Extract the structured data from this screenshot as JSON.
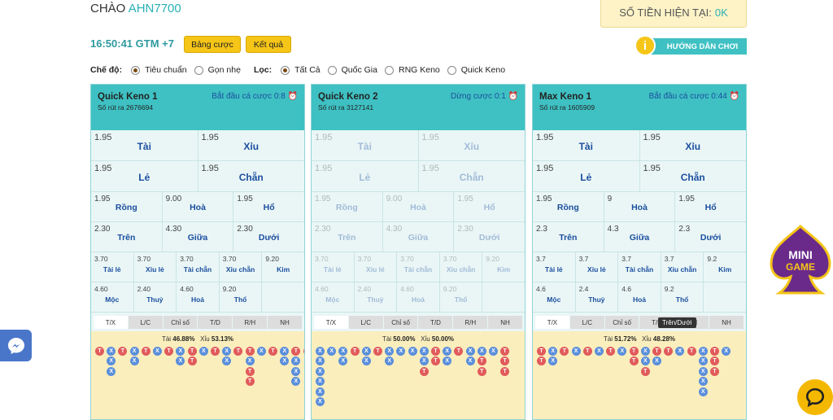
{
  "header": {
    "greeting": "CHÀO",
    "username": "AHN7700",
    "balance_label": "SỐ TIỀN HIỆN TẠI:",
    "balance_value": "0K",
    "clock": "16:50:41 GTM +7",
    "bets_button": "Bảng cược",
    "results_button": "Kết quả",
    "help_label": "HƯỚNG DẪN CHƠI",
    "help_icon": "i"
  },
  "mode": {
    "label": "Chế độ:",
    "options": [
      "Tiêu chuẩn",
      "Gọn nhẹ"
    ],
    "selected": 0
  },
  "filter": {
    "label": "Lọc:",
    "options": [
      "Tất Cả",
      "Quốc Gia",
      "RNG Keno",
      "Quick Keno"
    ],
    "selected": 0
  },
  "tabs": [
    "T/X",
    "L/C",
    "Chỉ số",
    "T/D",
    "R/H",
    "NH"
  ],
  "tooltip": "Trên/Dưới",
  "logo_text": [
    "MINI",
    "GAME"
  ],
  "panels": [
    {
      "name": "Quick Keno 1",
      "draw": "Số rút ra 2676694",
      "status": "Bắt đầu cá cược 0:8",
      "disabled": false,
      "r1": [
        [
          "1.95",
          "Tài"
        ],
        [
          "1.95",
          "Xỉu"
        ],
        [
          "1.95",
          "Lẻ"
        ],
        [
          "1.95",
          "Chẵn"
        ]
      ],
      "r2": [
        [
          "1.95",
          "Rồng"
        ],
        [
          "9.00",
          "Hoà"
        ],
        [
          "1.95",
          "Hổ"
        ],
        [
          "2.30",
          "Trên"
        ],
        [
          "4.30",
          "Giữa"
        ],
        [
          "2.30",
          "Dưới"
        ]
      ],
      "r3": [
        [
          "3.70",
          "Tài lẻ"
        ],
        [
          "3.70",
          "Xỉu lẻ"
        ],
        [
          "3.70",
          "Tài chẵn"
        ],
        [
          "3.70",
          "Xỉu chẵn"
        ],
        [
          "9.20",
          "Kim"
        ],
        [
          "4.60",
          "Mộc"
        ],
        [
          "2.40",
          "Thuỷ"
        ],
        [
          "4.60",
          "Hoả"
        ],
        [
          "9.20",
          "Thổ"
        ]
      ],
      "tai": "Tài",
      "tai_pct": "46.88%",
      "xiu": "Xỉu",
      "xiu_pct": "53.13%",
      "cols": [
        "T",
        "XXX",
        "T",
        "XX",
        "T",
        "X",
        "T",
        "XX",
        "TT",
        "X",
        "T",
        "XX",
        "T",
        "TXTT",
        "X",
        "T",
        "XX",
        "TXXX",
        "T",
        "XX",
        "X",
        "X"
      ]
    },
    {
      "name": "Quick Keno 2",
      "draw": "Số rút ra 3127141",
      "status": "Dừng cược 0:1",
      "disabled": true,
      "r1": [
        [
          "1.95",
          "Tài"
        ],
        [
          "1.95",
          "Xỉu"
        ],
        [
          "1.95",
          "Lẻ"
        ],
        [
          "1.95",
          "Chẵn"
        ]
      ],
      "r2": [
        [
          "1.95",
          "Rồng"
        ],
        [
          "9.00",
          "Hoà"
        ],
        [
          "1.95",
          "Hổ"
        ],
        [
          "2.30",
          "Trên"
        ],
        [
          "4.30",
          "Giữa"
        ],
        [
          "2.30",
          "Dưới"
        ]
      ],
      "r3": [
        [
          "3.70",
          "Tài lẻ"
        ],
        [
          "3.70",
          "Xỉu lẻ"
        ],
        [
          "3.70",
          "Tài chẵn"
        ],
        [
          "3.70",
          "Xỉu chẵn"
        ],
        [
          "9.20",
          "Kim"
        ],
        [
          "4.60",
          "Mộc"
        ],
        [
          "2.40",
          "Thuỷ"
        ],
        [
          "4.60",
          "Hoả"
        ],
        [
          "9.20",
          "Thổ"
        ]
      ],
      "tai": "Tài",
      "tai_pct": "50.00%",
      "xiu": "Xỉu",
      "xiu_pct": "50.00%",
      "cols": [
        "XXXXXX",
        "X",
        "XX",
        "T",
        "XX",
        "T",
        "XX",
        "X",
        "X",
        "XXT",
        "TT",
        "XX",
        "T",
        "XX",
        "XTT",
        "X",
        "TTT"
      ]
    },
    {
      "name": "Max Keno 1",
      "draw": "Số rút ra 1605909",
      "status": "Bắt đầu cá cược 0:44",
      "disabled": false,
      "r1": [
        [
          "1.95",
          "Tài"
        ],
        [
          "1.95",
          "Xỉu"
        ],
        [
          "1.95",
          "Lẻ"
        ],
        [
          "1.95",
          "Chẵn"
        ]
      ],
      "r2": [
        [
          "1.95",
          "Rồng"
        ],
        [
          "9",
          "Hoà"
        ],
        [
          "1.95",
          "Hổ"
        ],
        [
          "2.3",
          "Trên"
        ],
        [
          "4.3",
          "Giữa"
        ],
        [
          "2.3",
          "Dưới"
        ]
      ],
      "r3": [
        [
          "3.7",
          "Tài lẻ"
        ],
        [
          "3.7",
          "Xỉu lẻ"
        ],
        [
          "3.7",
          "Tài chẵn"
        ],
        [
          "3.7",
          "Xỉu chẵn"
        ],
        [
          "9.2",
          "Kim"
        ],
        [
          "4.6",
          "Mộc"
        ],
        [
          "2.4",
          "Thuỷ"
        ],
        [
          "4.6",
          "Hoả"
        ],
        [
          "9.2",
          "Thổ"
        ]
      ],
      "tai": "Tài",
      "tai_pct": "51.72%",
      "xiu": "Xỉu",
      "xiu_pct": "48.28%",
      "cols": [
        "TT",
        "XX",
        "T",
        "X",
        "T",
        "X",
        "T",
        "X",
        "TT",
        "XXT",
        "TX",
        "T",
        "X",
        "T",
        "XXXXX",
        "TTT",
        "X"
      ]
    }
  ]
}
